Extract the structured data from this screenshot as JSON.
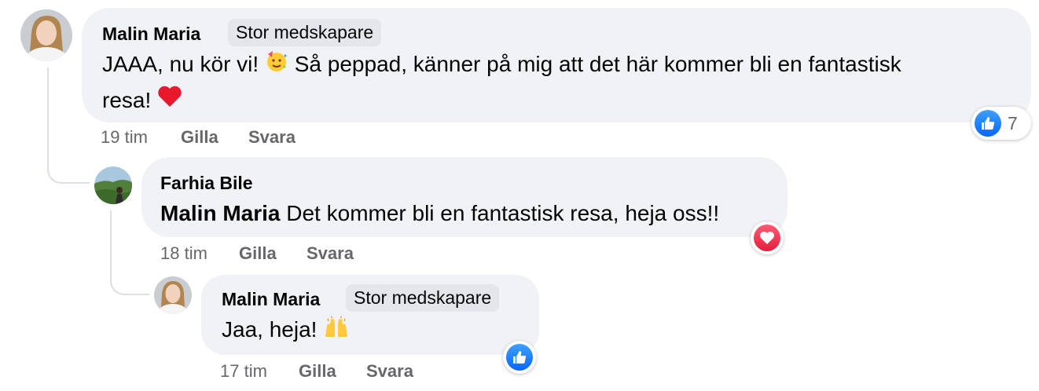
{
  "comments": [
    {
      "author": "Malin Maria",
      "badge": "Stor medskapare",
      "text_line1": "JAAA, nu kör vi!",
      "text_line1b": "Så peppad, känner på mig att det här kommer bli en fantastisk",
      "text_line2": "resa!",
      "time": "19 tim",
      "like_label": "Gilla",
      "reply_label": "Svara",
      "reaction_count": "7",
      "reaction_icon": "like-icon",
      "emojis": [
        "partying-face-emoji",
        "red-heart-emoji"
      ]
    },
    {
      "author": "Farhia Bile",
      "mention": "Malin Maria",
      "text": "Det kommer bli en fantastisk resa, heja oss!!",
      "time": "18 tim",
      "like_label": "Gilla",
      "reply_label": "Svara",
      "reaction_icon": "heart-icon"
    },
    {
      "author": "Malin Maria",
      "badge": "Stor medskapare",
      "text": "Jaa, heja!",
      "time": "17 tim",
      "like_label": "Gilla",
      "reply_label": "Svara",
      "reaction_icon": "like-icon",
      "emojis": [
        "raising-hands-emoji"
      ]
    }
  ],
  "colors": {
    "bubble": "#f0f2f5",
    "meta": "#65676b",
    "like": "#0866ff",
    "love": "#e41e3f"
  }
}
